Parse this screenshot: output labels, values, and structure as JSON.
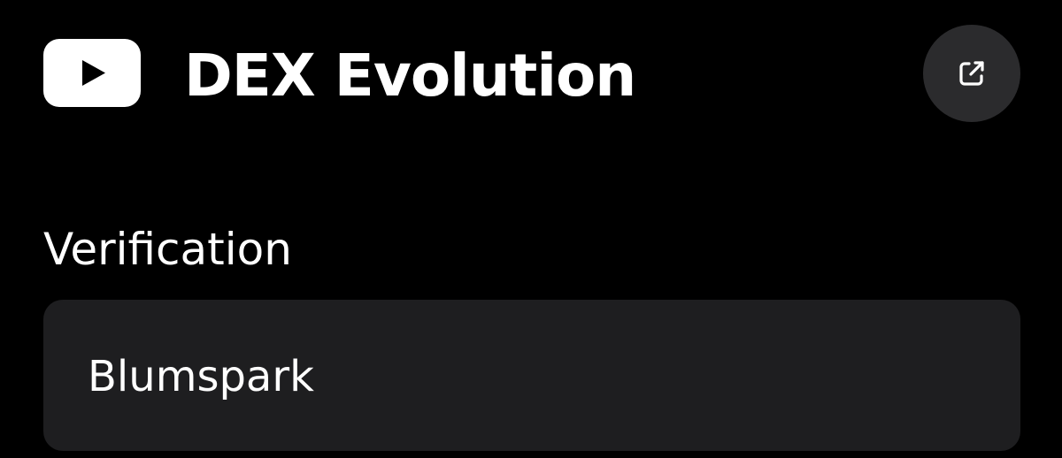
{
  "header": {
    "title": "DEX Evolution",
    "logo_icon": "youtube-logo-icon",
    "open_button_icon": "external-link-icon"
  },
  "verification": {
    "label": "Verification",
    "value": "Blumspark"
  },
  "colors": {
    "background": "#000000",
    "text": "#ffffff",
    "button_bg": "#2b2b2d",
    "field_bg": "#1e1e20"
  }
}
